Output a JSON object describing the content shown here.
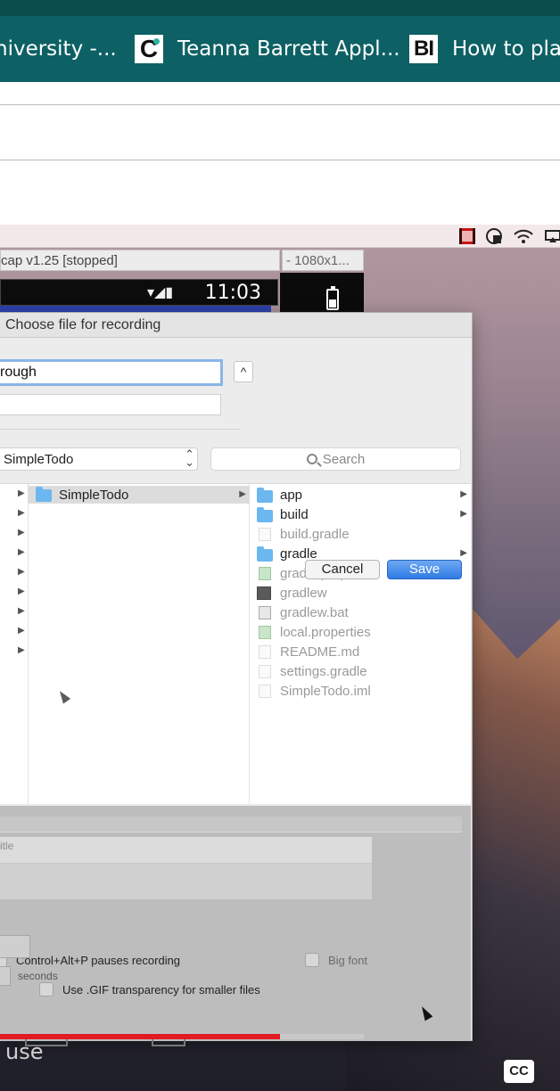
{
  "browser": {
    "tabs": [
      {
        "label": "niversity -...",
        "icon": "none"
      },
      {
        "label": "Teanna Barrett Appl...",
        "icon": "c-logo-icon",
        "icon_text": "C"
      },
      {
        "label": "How to play",
        "icon": "bi-logo-icon",
        "icon_text": "BI"
      }
    ],
    "tab_bar_color": "#0d6064"
  },
  "video": {
    "licecap_title": "cap v1.25 [stopped]",
    "emulator_title": "- 1080x1...",
    "android_time": "11:03",
    "dialog": {
      "title": "Choose file for recording",
      "save_as_value": "rough",
      "expand_label": "^",
      "location": "SimpleTodo",
      "search_placeholder": "Search",
      "sidebar_folder": "SimpleTodo",
      "files": [
        {
          "name": "app",
          "icon": "folder-icon",
          "style": "dark",
          "has_children": true
        },
        {
          "name": "build",
          "icon": "folder-icon",
          "style": "dark",
          "has_children": true
        },
        {
          "name": "build.gradle",
          "icon": "file-icon",
          "style": "grey",
          "has_children": false
        },
        {
          "name": "gradle",
          "icon": "folder-icon",
          "style": "dark",
          "has_children": true
        },
        {
          "name": "gradle.properties",
          "icon": "properties-file-icon",
          "style": "grey",
          "has_children": false
        },
        {
          "name": "gradlew",
          "icon": "exec-file-icon",
          "style": "grey",
          "has_children": false
        },
        {
          "name": "gradlew.bat",
          "icon": "bat-file-icon",
          "style": "grey",
          "has_children": false
        },
        {
          "name": "local.properties",
          "icon": "properties-file-icon",
          "style": "grey",
          "has_children": false
        },
        {
          "name": "README.md",
          "icon": "file-icon",
          "style": "grey",
          "has_children": false
        },
        {
          "name": "settings.gradle",
          "icon": "file-icon",
          "style": "grey",
          "has_children": false
        },
        {
          "name": "SimpleTodo.iml",
          "icon": "file-icon",
          "style": "grey",
          "has_children": false
        }
      ],
      "title_placeholder": "itle",
      "pause_hint": "Control+Alt+P pauses recording",
      "big_font_label": "Big font",
      "gif_transparency_label": "Use .GIF transparency for smaller files",
      "seconds_label": "seconds",
      "cancel_label": "Cancel",
      "save_label": "Save"
    },
    "overlay_text": "use",
    "cc_label": "CC",
    "progress_fraction": 0.77
  }
}
